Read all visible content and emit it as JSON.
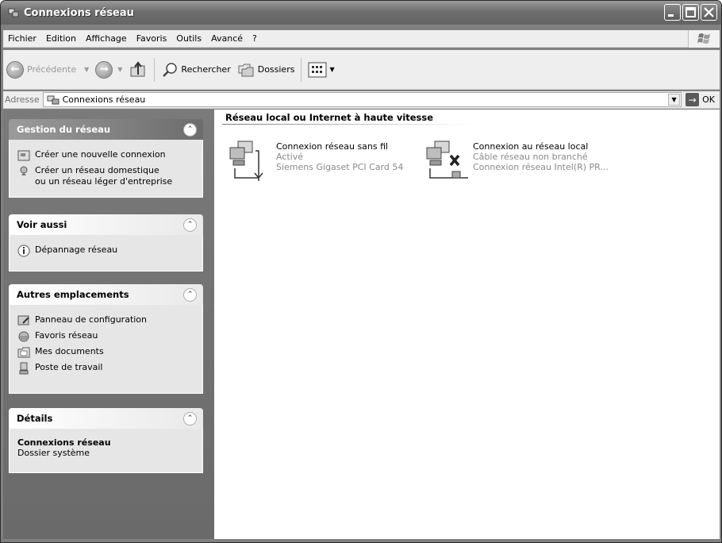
{
  "window": {
    "title": "Connexions réseau"
  },
  "menu": [
    "Fichier",
    "Edition",
    "Affichage",
    "Favoris",
    "Outils",
    "Avancé",
    "?"
  ],
  "toolbar": {
    "back_label": "Précédente",
    "search_label": "Rechercher",
    "folders_label": "Dossiers"
  },
  "address": {
    "label": "Adresse",
    "value": "Connexions réseau",
    "go_label": "OK"
  },
  "sidebar": {
    "network_tasks": {
      "title": "Gestion du réseau",
      "items": [
        "Créer une nouvelle connexion",
        "Créer un réseau domestique",
        "ou un réseau léger d'entreprise"
      ]
    },
    "see_also": {
      "title": "Voir aussi",
      "items": [
        "Dépannage réseau"
      ]
    },
    "other_places": {
      "title": "Autres emplacements",
      "items": [
        "Panneau de configuration",
        "Favoris réseau",
        "Mes documents",
        "Poste de travail"
      ]
    },
    "details": {
      "title": "Détails",
      "name": "Connexions réseau",
      "type": "Dossier système"
    }
  },
  "content": {
    "group_title": "Réseau local ou Internet à haute vitesse",
    "connections": [
      {
        "name": "Connexion réseau sans fil",
        "status": "Activé",
        "device": "Siemens Gigaset PCI Card 54"
      },
      {
        "name": "Connexion au réseau local",
        "status": "Câble réseau non branché",
        "device": "Connexion réseau Intel(R) PR..."
      }
    ]
  }
}
